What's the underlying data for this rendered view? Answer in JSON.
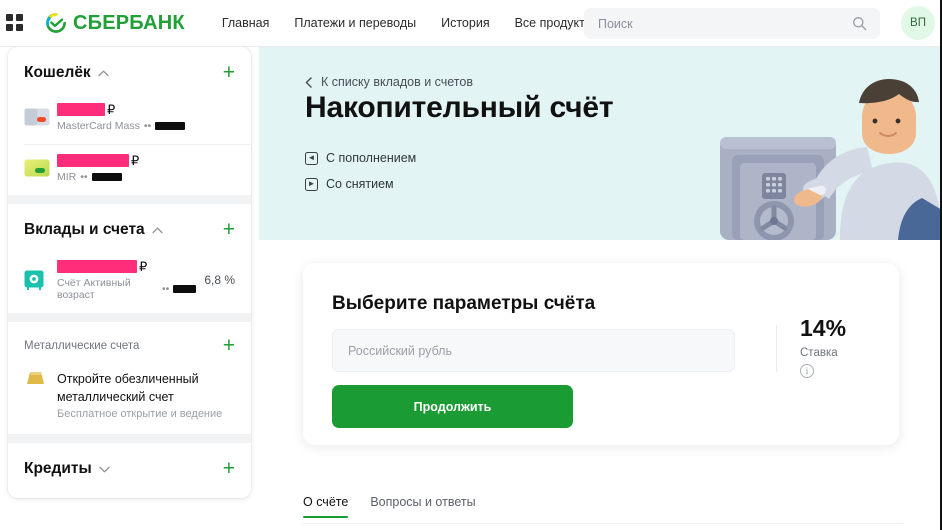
{
  "header": {
    "apps_icon": "grid-apps-icon",
    "brand": "СБЕРБАНК",
    "nav": [
      {
        "label": "Главная"
      },
      {
        "label": "Платежи и переводы"
      },
      {
        "label": "История"
      },
      {
        "label": "Все продукты"
      }
    ],
    "search": {
      "placeholder": "Поиск",
      "value": "",
      "icon": "search-icon"
    },
    "avatar_initials": "ВП"
  },
  "sidebar": {
    "groups": [
      {
        "title": "Кошелёк",
        "title_style": "large",
        "chevron": "chevron-up-icon",
        "add_label": "+",
        "rows": [
          {
            "icon": "bank-card-icon",
            "amount_redacted": true,
            "redact_width": 48,
            "currency": "₽",
            "subtitle": "MasterCard Mass",
            "mask_dots": "••",
            "digits_redacted": true
          },
          {
            "icon": "bank-card-icon",
            "amount_redacted": true,
            "redact_width": 72,
            "currency": "₽",
            "subtitle": "MIR",
            "mask_dots": "••",
            "digits_redacted": true
          }
        ]
      },
      {
        "title": "Вклады и счета",
        "title_style": "large",
        "chevron": "chevron-up-icon",
        "add_label": "+",
        "rows": [
          {
            "icon": "safe-vault-icon",
            "amount_redacted": true,
            "redact_width": 80,
            "currency": "₽",
            "subtitle": "Счёт Активный возраст",
            "mask_dots": "••",
            "digits_redacted": true,
            "rate": "6,8 %"
          }
        ]
      },
      {
        "title": "Металлические счета",
        "title_style": "small",
        "chevron": "",
        "add_label": "+",
        "promo": {
          "icon": "gold-bar-icon",
          "title": "Откройте обезличенный металлический счет",
          "subtitle": "Бесплатное открытие и ведение"
        }
      },
      {
        "title": "Кредиты",
        "title_style": "large",
        "chevron": "chevron-down-icon",
        "add_label": "+",
        "rows": []
      }
    ]
  },
  "hero": {
    "back_link": "К списку вкладов и счетов",
    "back_icon": "chevron-left-icon",
    "title": "Накопительный счёт",
    "features": [
      {
        "label": "С пополнением",
        "icon": "deposit-in-icon",
        "glyph": "◄"
      },
      {
        "label": "Со снятием",
        "icon": "withdraw-out-icon",
        "glyph": "►"
      }
    ],
    "illustration": "man-leaning-on-safe-illustration",
    "bg_color": "#e2f4f4"
  },
  "params_card": {
    "title": "Выберите параметры счёта",
    "currency_field": {
      "placeholder": "Российский рубль",
      "value": ""
    },
    "submit_label": "Продолжить",
    "rate_value": "14%",
    "rate_label": "Ставка",
    "info_icon": "info-icon",
    "accent_color": "#1a9b33"
  },
  "tabs": [
    {
      "label": "О счёте",
      "active": true
    },
    {
      "label": "Вопросы и ответы",
      "active": false
    }
  ]
}
